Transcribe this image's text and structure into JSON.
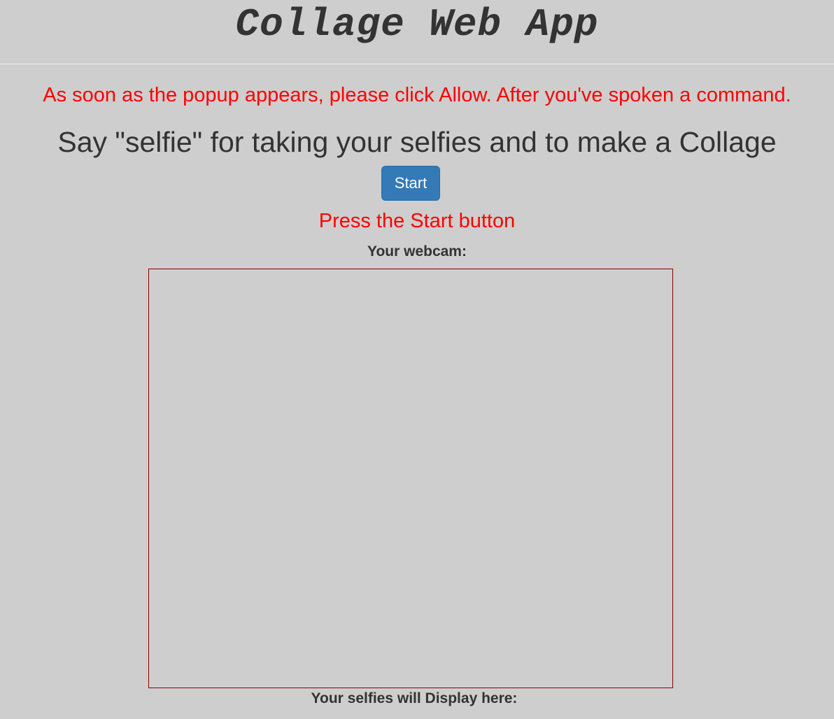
{
  "header": {
    "title": "Collage Web App"
  },
  "main": {
    "instruction": "As soon as the popup appears, please click Allow. After you've spoken a command.",
    "headline": "Say \"selfie\" for taking your selfies and to make a Collage",
    "start_button_label": "Start",
    "status_text": "Press the Start button",
    "webcam_label": "Your webcam:",
    "selfies_label": "Your selfies will Display here:"
  },
  "colors": {
    "background": "#cecece",
    "text": "#333333",
    "alert_text": "#ff0000",
    "button": "#337ab7",
    "webcam_border": "#8b0000"
  }
}
